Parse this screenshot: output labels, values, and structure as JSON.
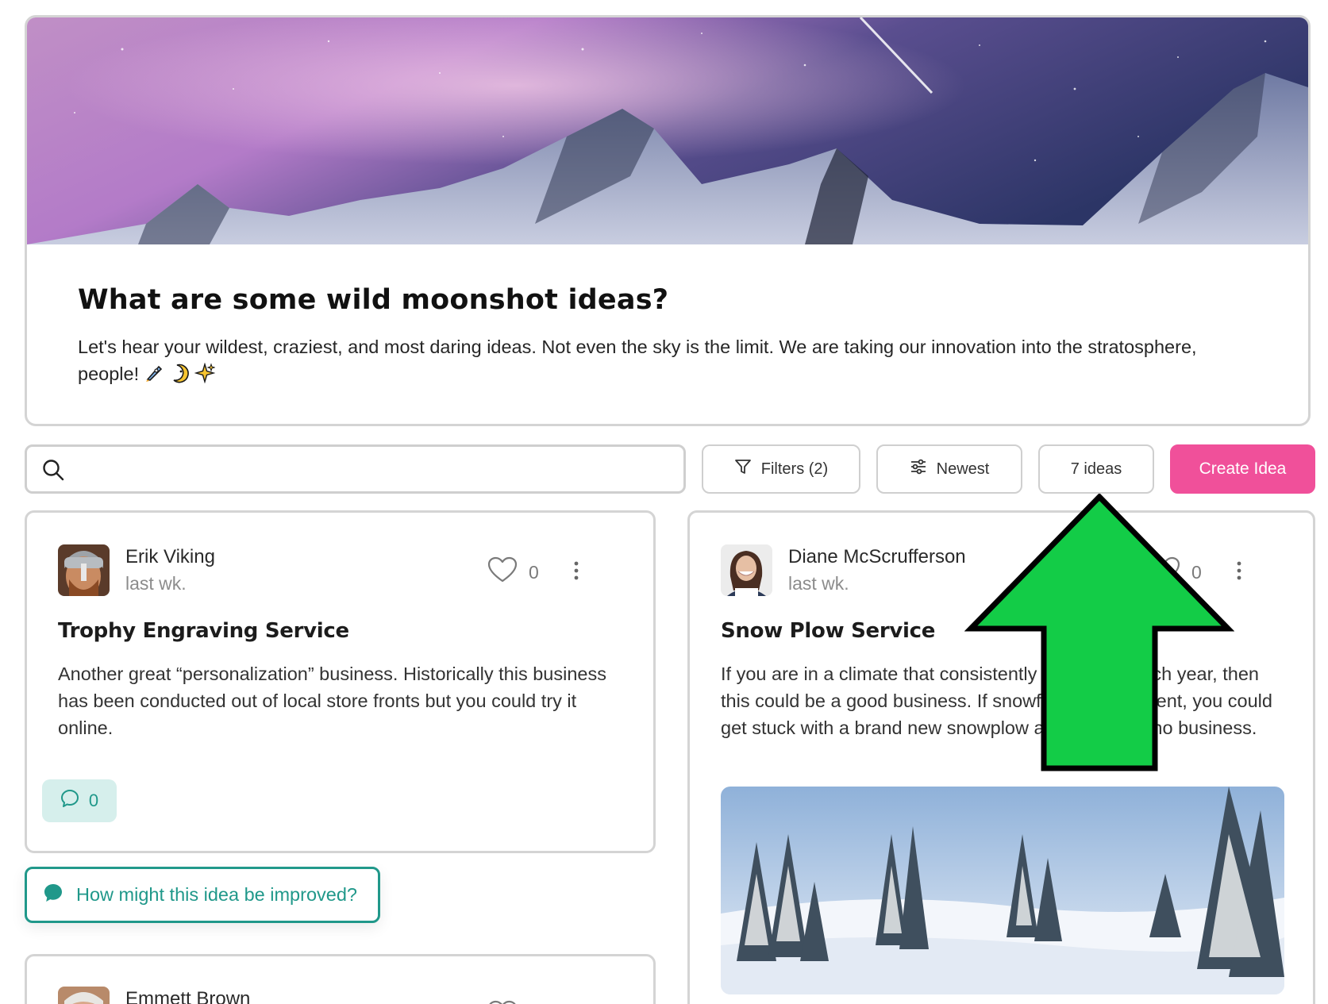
{
  "hero": {
    "title": "What are some wild moonshot ideas?",
    "description": "Let's hear your wildest, craziest, and most daring ideas. Not even the sky is the limit. We are taking our innovation into the stratosphere, people!"
  },
  "toolbar": {
    "search_value": "",
    "filters_label": "Filters (2)",
    "sort_label": "Newest",
    "count_label": "7 ideas",
    "create_label": "Create Idea"
  },
  "ideas": [
    {
      "author": "Erik Viking",
      "time": "last wk.",
      "likes": "0",
      "title": "Trophy Engraving Service",
      "body": "Another great “personalization” business. Historically this business has been conducted out of local store fronts but you could try it online.",
      "comments": "0"
    },
    {
      "author": "Diane McScrufferson",
      "time": "last wk.",
      "likes": "0",
      "title": "Snow Plow Service",
      "body": "If you are in a climate that consistently gets snow each year, then this could be a good business. If snowfall is inconsistent, you could get stuck with a brand new snowplow and truck, but no business."
    },
    {
      "author": "Emmett Brown"
    }
  ],
  "improve_prompt": "How might this idea be improved?",
  "colors": {
    "accent_pink": "#f0509a",
    "teal": "#20988a",
    "annotation_arrow": "#13cc47"
  },
  "icons": [
    "search-icon",
    "filter-icon",
    "sliders-icon",
    "heart-icon",
    "more-vertical-icon",
    "comment-icon",
    "chat-bubble-icon",
    "rocket-emoji",
    "moon-emoji",
    "sparkles-emoji"
  ]
}
